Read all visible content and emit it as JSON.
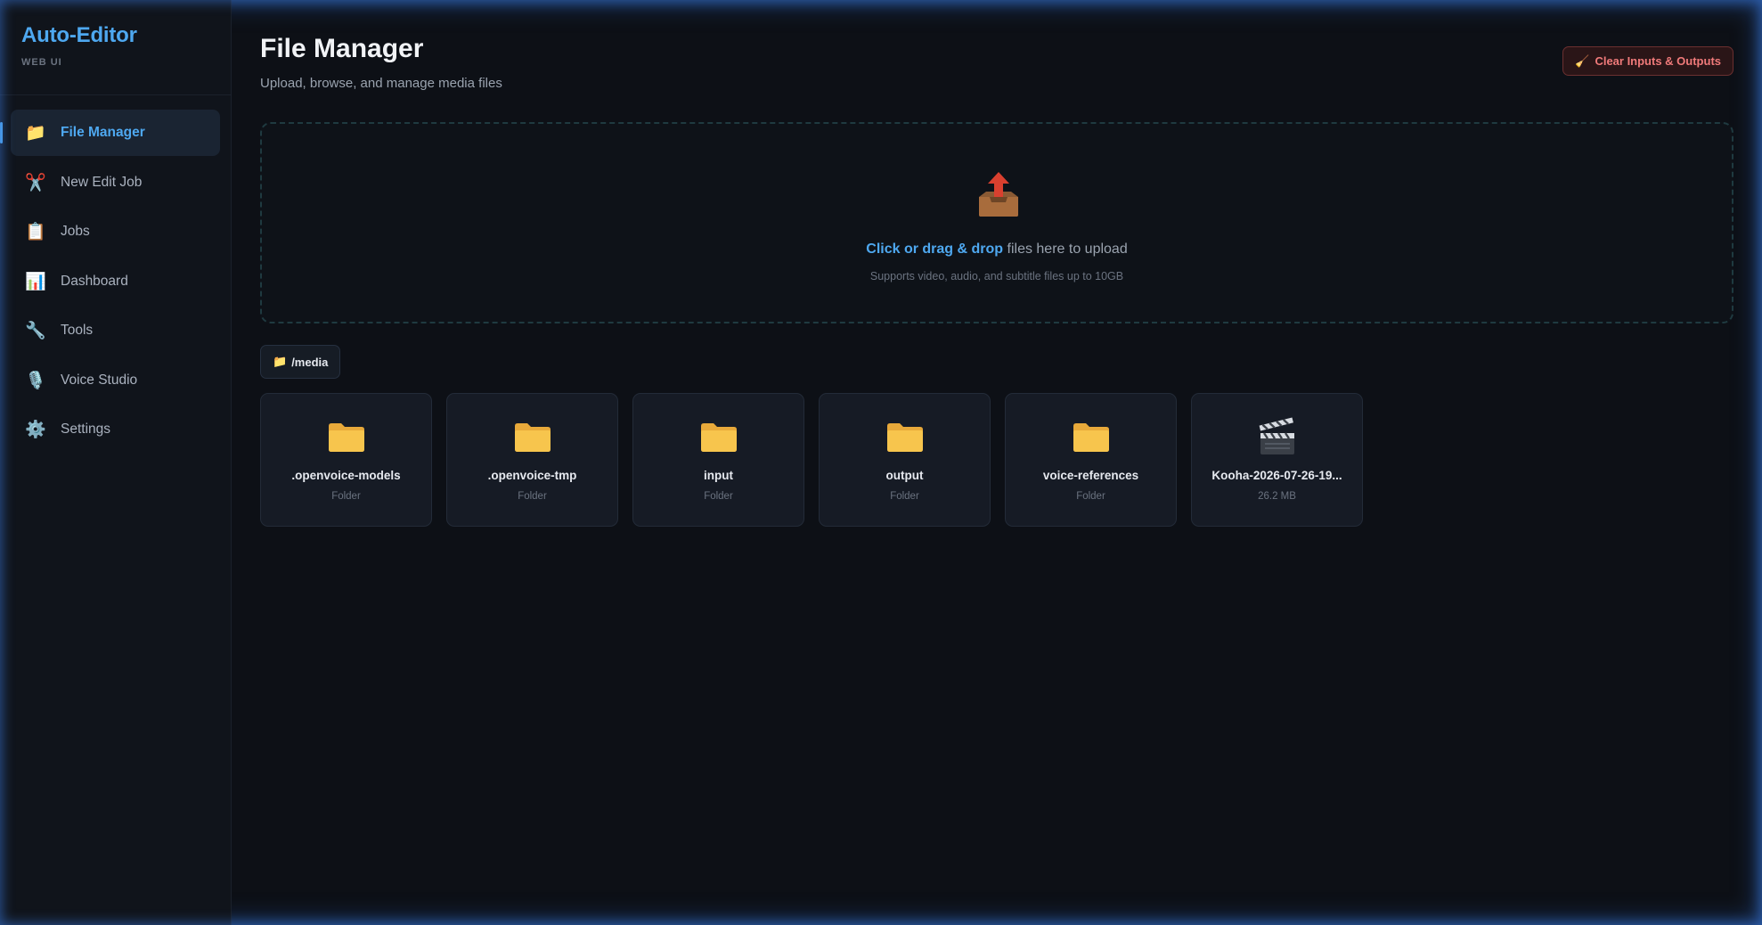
{
  "sidebar": {
    "title": "Auto-Editor",
    "subtitle": "WEB UI",
    "items": [
      {
        "label": "File Manager",
        "icon": "folder-icon",
        "active": true
      },
      {
        "label": "New Edit Job",
        "icon": "scissors-icon"
      },
      {
        "label": "Jobs",
        "icon": "clipboard-icon"
      },
      {
        "label": "Dashboard",
        "icon": "bar-chart-icon"
      },
      {
        "label": "Tools",
        "icon": "wrench-icon"
      },
      {
        "label": "Voice Studio",
        "icon": "microphone-icon"
      },
      {
        "label": "Settings",
        "icon": "gear-icon"
      }
    ]
  },
  "header": {
    "title": "File Manager",
    "subtitle": "Upload, browse, and manage media files",
    "clear_button": "Clear Inputs & Outputs"
  },
  "upload": {
    "link_text": "Click or drag & drop",
    "rest_text": " files here to upload",
    "hint": "Supports video, audio, and subtitle files up to 10GB"
  },
  "breadcrumb": {
    "path": "/media"
  },
  "files": [
    {
      "name": ".openvoice-models",
      "meta": "Folder",
      "type": "folder"
    },
    {
      "name": ".openvoice-tmp",
      "meta": "Folder",
      "type": "folder"
    },
    {
      "name": "input",
      "meta": "Folder",
      "type": "folder"
    },
    {
      "name": "output",
      "meta": "Folder",
      "type": "folder"
    },
    {
      "name": "voice-references",
      "meta": "Folder",
      "type": "folder"
    },
    {
      "name": "Kooha-2026-07-26-19...",
      "meta": "26.2 MB",
      "type": "video"
    }
  ],
  "colors": {
    "accent": "#4ea8f0",
    "danger": "#f07a7a",
    "background": "#0d1016"
  }
}
